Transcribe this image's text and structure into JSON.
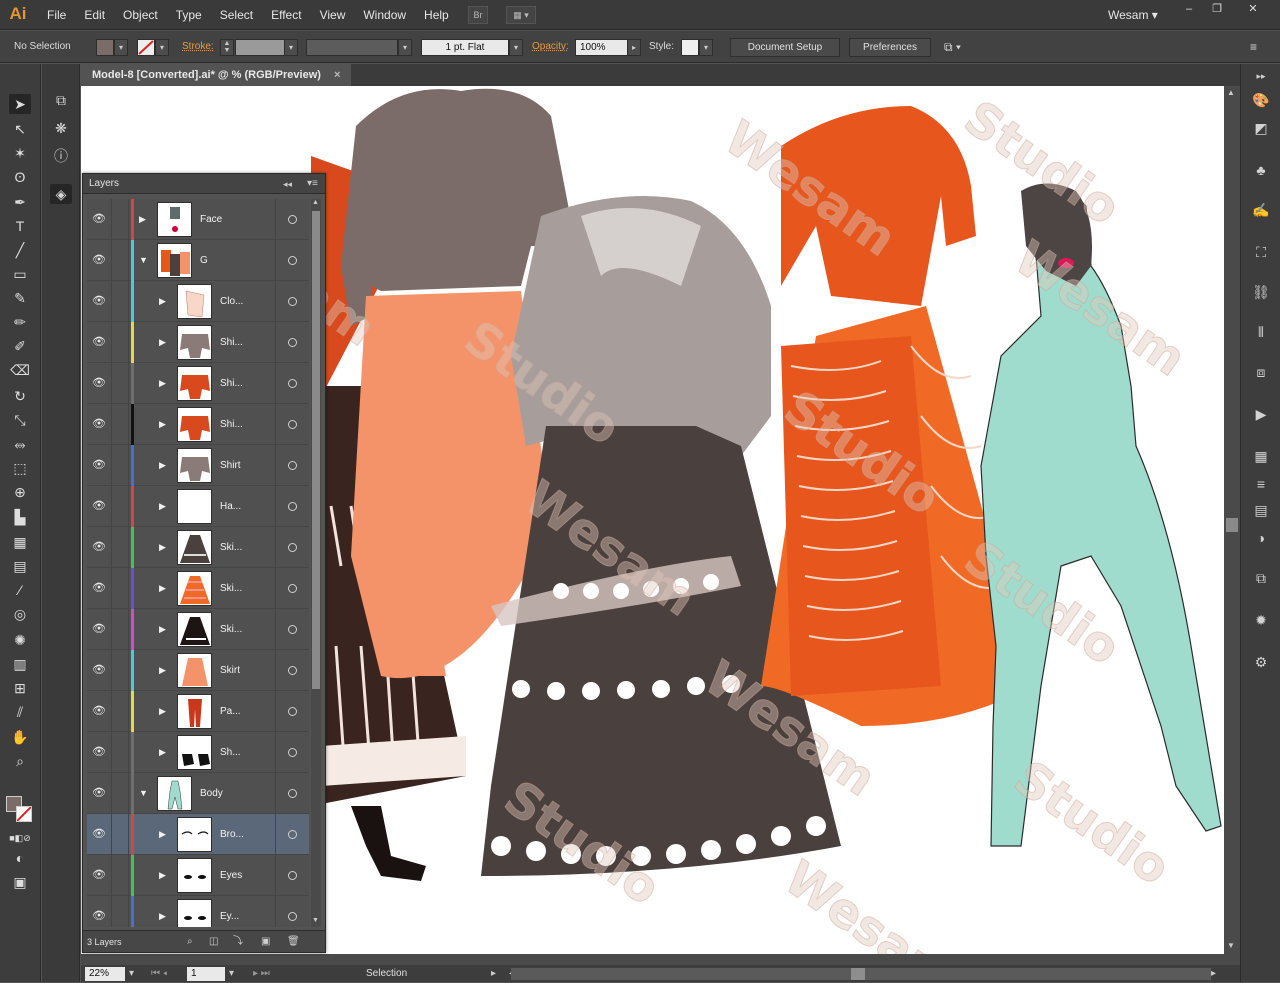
{
  "app": {
    "logo": "Ai",
    "workspace": "Wesam",
    "bridge_label": "Br"
  },
  "menu": [
    "File",
    "Edit",
    "Object",
    "Type",
    "Select",
    "Effect",
    "View",
    "Window",
    "Help"
  ],
  "window_controls": {
    "minimize": "–",
    "restore": "❐",
    "close": "✕"
  },
  "control_bar": {
    "selection_status": "No Selection",
    "stroke_label": "Stroke:",
    "brush_profile": "1 pt. Flat",
    "opacity_label": "Opacity:",
    "opacity_value": "100%",
    "style_label": "Style:",
    "document_setup": "Document Setup",
    "preferences": "Preferences"
  },
  "document": {
    "tab_title": "Model-8 [Converted].ai* @ % (RGB/Preview)",
    "close": "×"
  },
  "layers_panel": {
    "title": "Layers",
    "collapse_glyph": "◂◂",
    "menu_glyph": "▾≡",
    "footer_count": "3 Layers",
    "rows": [
      {
        "name": "Face",
        "color": "#d64545",
        "level": 0,
        "expanded": false,
        "thumb": "face"
      },
      {
        "name": "G",
        "color": "#4ec9d8",
        "level": 0,
        "expanded": true,
        "thumb": "group"
      },
      {
        "name": "Clo...",
        "color": "#4ec9d8",
        "level": 1,
        "expanded": false,
        "thumb": "cloth"
      },
      {
        "name": "Shi...",
        "color": "#e4d84a",
        "level": 1,
        "expanded": false,
        "thumb": "shirt-grey"
      },
      {
        "name": "Shi...",
        "color": "#6f6f6f",
        "level": 1,
        "expanded": false,
        "thumb": "shirt-orange"
      },
      {
        "name": "Shi...",
        "color": "#111111",
        "level": 1,
        "expanded": false,
        "thumb": "shirt-orange"
      },
      {
        "name": "Shirt",
        "color": "#4b6fd0",
        "level": 1,
        "expanded": false,
        "thumb": "shirt-grey"
      },
      {
        "name": "Ha...",
        "color": "#d64545",
        "level": 1,
        "expanded": false,
        "thumb": "blank"
      },
      {
        "name": "Ski...",
        "color": "#46c15a",
        "level": 1,
        "expanded": false,
        "thumb": "skirt-brown"
      },
      {
        "name": "Ski...",
        "color": "#6b4fd0",
        "level": 1,
        "expanded": false,
        "thumb": "skirt-orange"
      },
      {
        "name": "Ski...",
        "color": "#cc4fc4",
        "level": 1,
        "expanded": false,
        "thumb": "skirt-black"
      },
      {
        "name": "Skirt",
        "color": "#4ec9d8",
        "level": 1,
        "expanded": false,
        "thumb": "skirt-peach"
      },
      {
        "name": "Pa...",
        "color": "#e4d84a",
        "level": 1,
        "expanded": false,
        "thumb": "pants"
      },
      {
        "name": "Sh...",
        "color": "#6f6f6f",
        "level": 1,
        "expanded": false,
        "thumb": "shoes"
      },
      {
        "name": "Body",
        "color": "#6f6f6f",
        "level": 0,
        "expanded": true,
        "thumb": "body"
      },
      {
        "name": "Bro...",
        "color": "#d64545",
        "level": 1,
        "expanded": false,
        "thumb": "brows",
        "selected": true
      },
      {
        "name": "Eyes",
        "color": "#46c15a",
        "level": 1,
        "expanded": false,
        "thumb": "eyes"
      },
      {
        "name": "Ey...",
        "color": "#4b6fd0",
        "level": 1,
        "expanded": false,
        "thumb": "eyes"
      }
    ]
  },
  "status_bar": {
    "zoom": "22%",
    "artboard": "1",
    "tool_status": "Selection"
  },
  "watermark": {
    "line1": "Wesam",
    "line2": "Studio"
  },
  "colors": {
    "accent_orange": "#e8932c",
    "shirt_grey": "#7b6c6a",
    "skirt_dark": "#4a403d",
    "orange": "#e6561d",
    "peach": "#f4936a",
    "body_mint": "#9fdccd"
  },
  "icons": {
    "tools": [
      "selection-icon",
      "direct-selection-icon",
      "magic-wand-icon",
      "lasso-icon",
      "pen-icon",
      "type-icon",
      "line-icon",
      "rectangle-icon",
      "paintbrush-icon",
      "pencil-icon",
      "blob-brush-icon",
      "eraser-icon",
      "rotate-icon",
      "scale-icon",
      "width-icon",
      "free-transform-icon",
      "shape-builder-icon",
      "graph-icon",
      "mesh-icon",
      "gradient-icon",
      "eyedropper-icon",
      "blend-icon",
      "symbol-sprayer-icon",
      "column-graph-icon",
      "artboard-icon",
      "slice-icon",
      "hand-icon",
      "zoom-icon"
    ]
  }
}
